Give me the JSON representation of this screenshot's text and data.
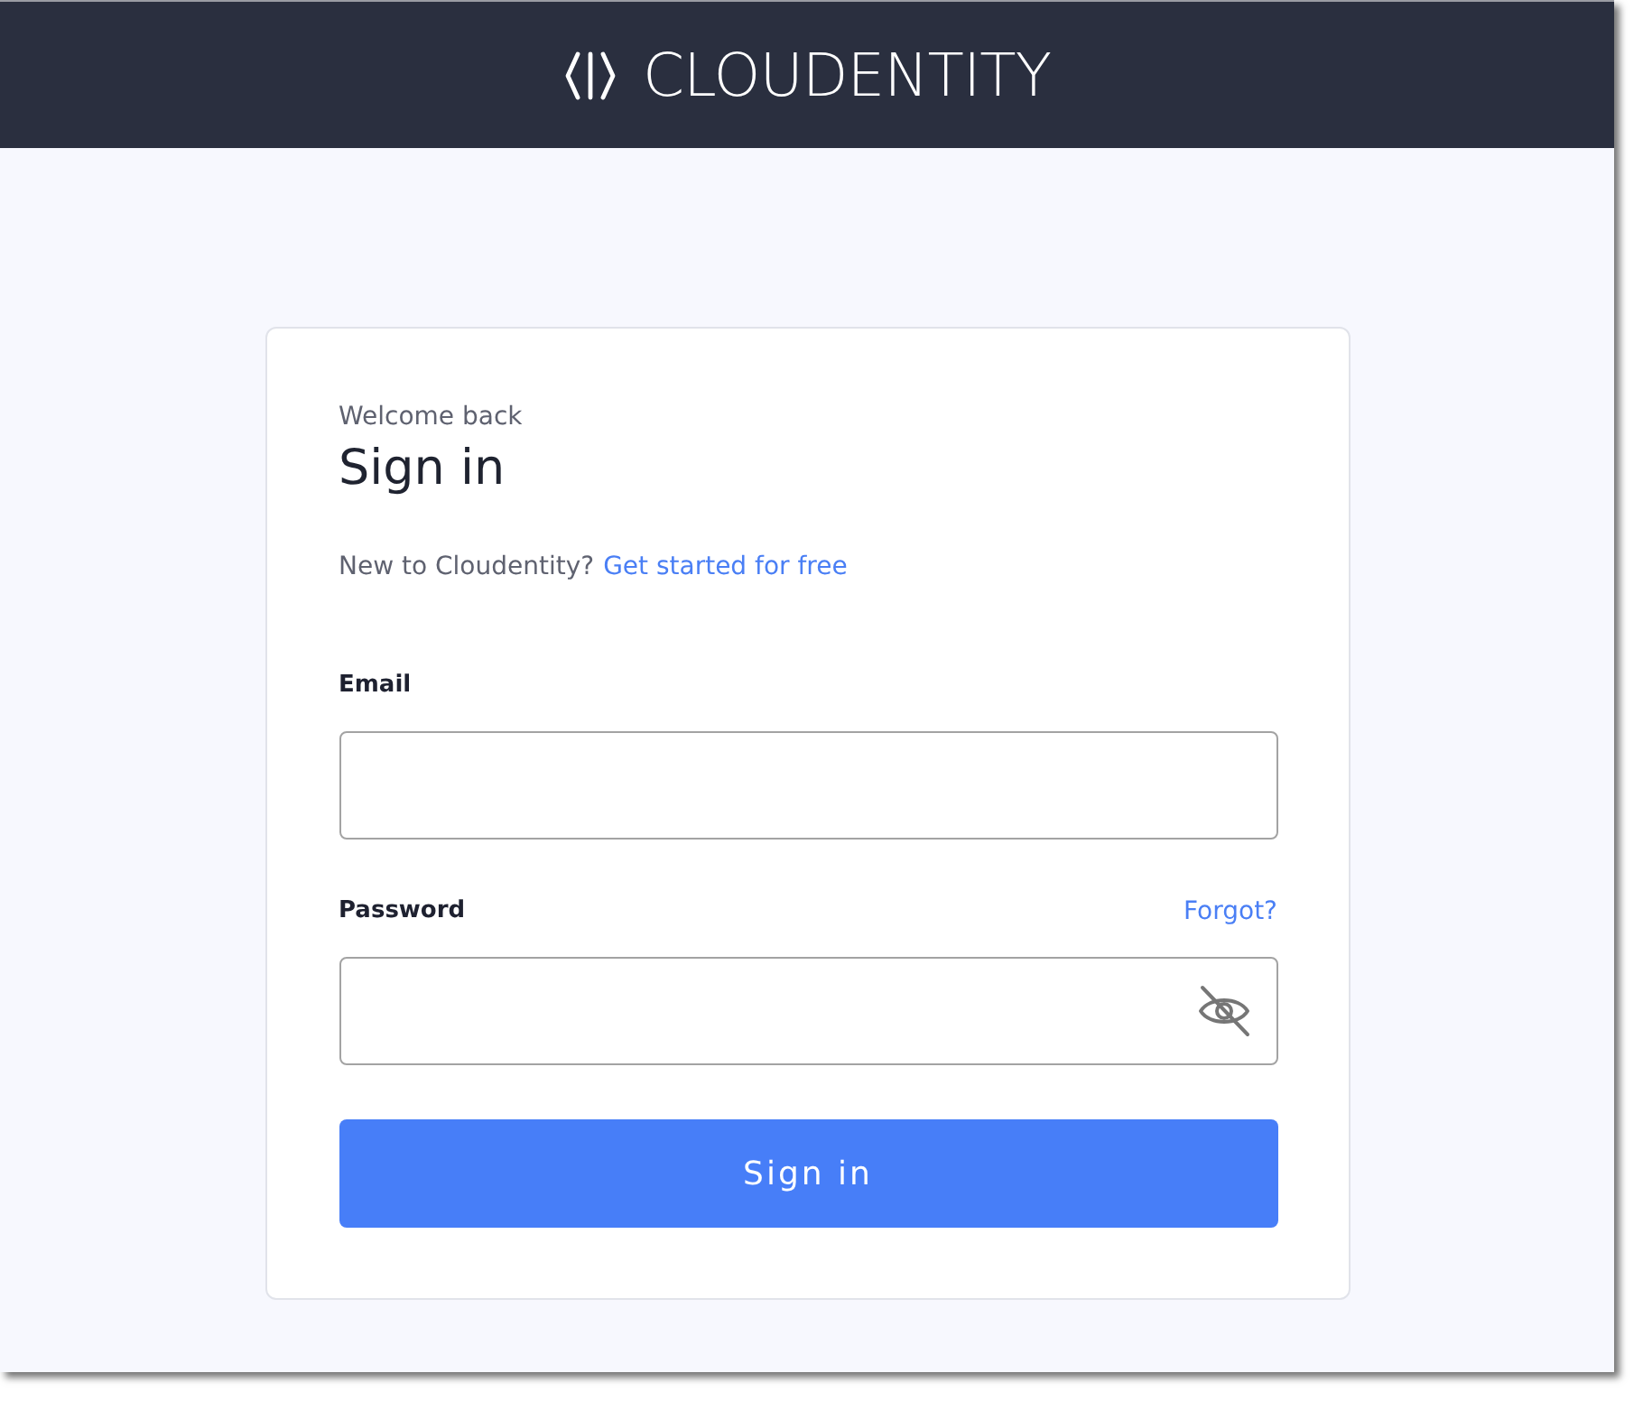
{
  "header": {
    "logo_text": "CLOUDENTITY"
  },
  "card": {
    "eyebrow": "Welcome back",
    "title": "Sign in",
    "signup": {
      "prompt": "New to Cloudentity?",
      "link": "Get started for free"
    },
    "fields": [
      {
        "kind": "email",
        "label": "Email"
      },
      {
        "kind": "password",
        "label": "Password",
        "link": "Forgot?",
        "revealed": false
      }
    ],
    "submit": "Sign in"
  }
}
